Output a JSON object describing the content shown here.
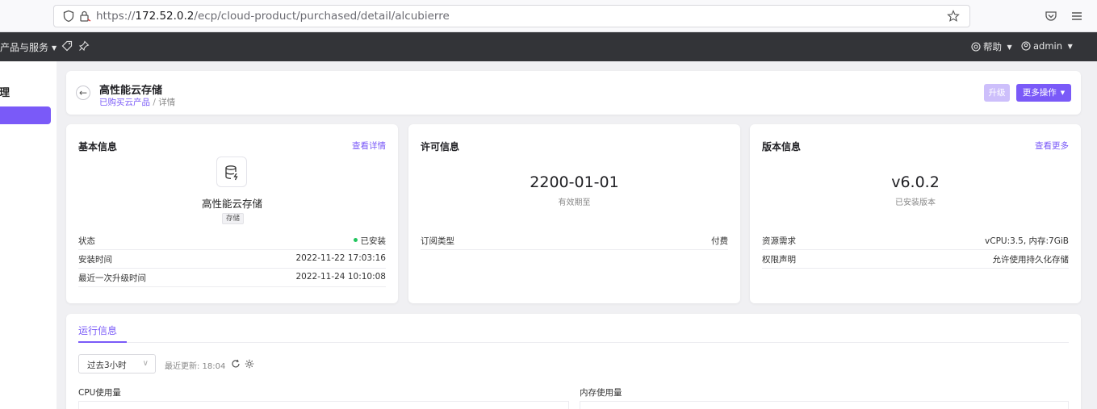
{
  "browser": {
    "url_prefix": "https://",
    "url_host": "172.52.0.2",
    "url_path": "/ecp/cloud-product/purchased/detail/alcubierre"
  },
  "topnav": {
    "products_label": "产品与服务",
    "help_label": "帮助",
    "user_label": "admin"
  },
  "sidebar": {
    "title": "管理"
  },
  "header": {
    "title": "高性能云存储",
    "crumb_parent": "已购买云产品",
    "crumb_sep": " / ",
    "crumb_current": "详情",
    "upgrade_label": "升级",
    "more_label": "更多操作"
  },
  "basic": {
    "title": "基本信息",
    "link": "查看详情",
    "product_name": "高性能云存储",
    "tag": "存储",
    "rows": [
      {
        "key": "状态",
        "value": "已安装"
      },
      {
        "key": "安装时间",
        "value": "2022-11-22 17:03:16"
      },
      {
        "key": "最近一次升级时间",
        "value": "2022-11-24 10:10:08"
      }
    ]
  },
  "license": {
    "title": "许可信息",
    "expiry": "2200-01-01",
    "expiry_label": "有效期至",
    "rows": [
      {
        "key": "订阅类型",
        "value": "付费"
      }
    ]
  },
  "version": {
    "title": "版本信息",
    "link": "查看更多",
    "version": "v6.0.2",
    "version_label": "已安装版本",
    "rows": [
      {
        "key": "资源需求",
        "value": "vCPU:3.5, 内存:7GiB"
      },
      {
        "key": "权限声明",
        "value": "允许使用持久化存储"
      }
    ]
  },
  "runtime": {
    "tab": "运行信息",
    "range": "过去3小时",
    "last_update": "最近更新: 18:04",
    "cpu_label": "CPU使用量",
    "mem_label": "内存使用量"
  },
  "colors": {
    "accent": "#7a5af8",
    "status_ok": "#22c55e"
  }
}
